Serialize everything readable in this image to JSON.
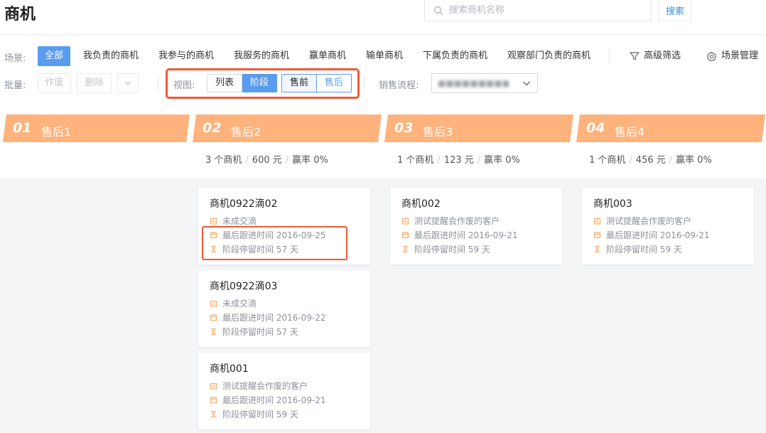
{
  "page": {
    "title": "商机"
  },
  "search": {
    "placeholder": "搜索商机名称",
    "button_label": "搜索"
  },
  "scenes": {
    "label": "场景:",
    "items": [
      "全部",
      "我负责的商机",
      "我参与的商机",
      "我服务的商机",
      "赢单商机",
      "输单商机",
      "下属负责的商机",
      "观察部门负责的商机"
    ],
    "active_index": 0,
    "advanced_filter": "高级筛选",
    "scene_manage": "场景管理"
  },
  "batch": {
    "label": "批量:",
    "void_label": "作废",
    "delete_label": "删除"
  },
  "view": {
    "label": "视图:",
    "list_label": "列表",
    "stage_label": "阶段",
    "active": "阶段"
  },
  "phase": {
    "presale_label": "售前",
    "aftersale_label": "售后",
    "active": "售前"
  },
  "sales_flow": {
    "label": "销售流程:",
    "value": "■■■■■■■■■..."
  },
  "colors": {
    "accent": "#5a9cf0",
    "stage": "#feb27c",
    "highlight": "#ef5a34",
    "card_icon": "#f3a866"
  },
  "stages": [
    {
      "num": "01",
      "name": "售后1",
      "stats": null,
      "cards": []
    },
    {
      "num": "02",
      "name": "售后2",
      "stats": {
        "count": "3 个商机",
        "amount": "600 元",
        "win_rate": "赢率 0%"
      },
      "cards": [
        {
          "title": "商机0922滴02",
          "customer": "未成交滴",
          "last_follow": "最后跟进时间 2016-09-25",
          "stay": "阶段停留时间 57 天"
        },
        {
          "title": "商机0922滴03",
          "customer": "未成交滴",
          "last_follow": "最后跟进时间 2016-09-22",
          "stay": "阶段停留时间 57 天"
        },
        {
          "title": "商机001",
          "customer": "测试提醒会作废的客户",
          "last_follow": "最后跟进时间 2016-09-21",
          "stay": "阶段停留时间 59 天"
        }
      ]
    },
    {
      "num": "03",
      "name": "售后3",
      "stats": {
        "count": "1 个商机",
        "amount": "123 元",
        "win_rate": "赢率 0%"
      },
      "cards": [
        {
          "title": "商机002",
          "customer": "测试提醒会作废的客户",
          "last_follow": "最后跟进时间 2016-09-21",
          "stay": "阶段停留时间 59 天"
        }
      ]
    },
    {
      "num": "04",
      "name": "售后4",
      "stats": {
        "count": "1 个商机",
        "amount": "456 元",
        "win_rate": "赢率 0%"
      },
      "cards": [
        {
          "title": "商机003",
          "customer": "测试提醒会作废的客户",
          "last_follow": "最后跟进时间 2016-09-21",
          "stay": "阶段停留时间 59 天"
        }
      ]
    }
  ],
  "icons": {
    "search": "search-icon",
    "filter": "filter-icon",
    "settings": "gear-icon",
    "chevron": "chevron-down-icon",
    "customer": "building-icon",
    "calendar": "calendar-icon",
    "hourglass": "hourglass-icon"
  }
}
